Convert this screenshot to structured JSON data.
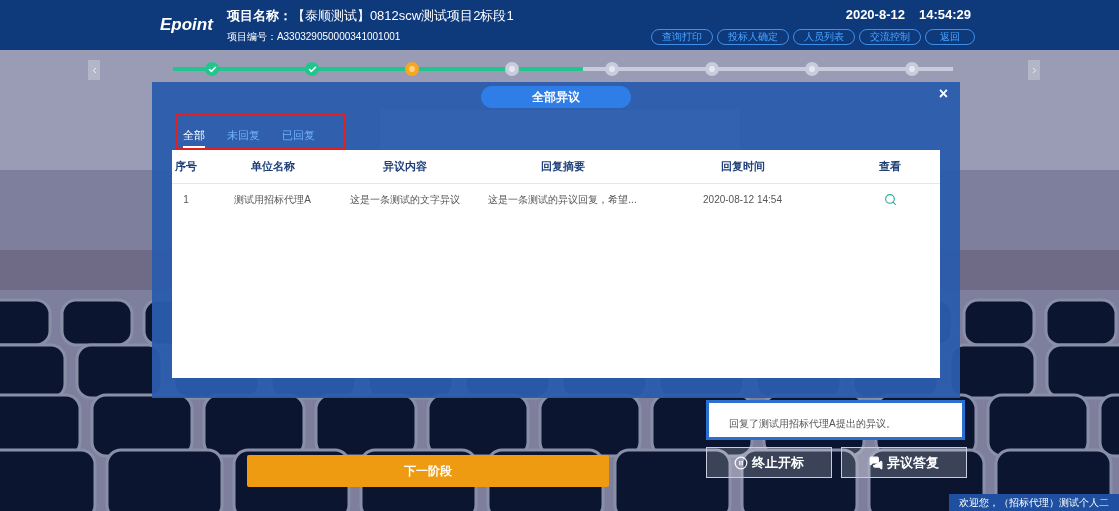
{
  "header": {
    "logo": "Epoint",
    "project_label": "项目名称：",
    "project_name": "【泰顺测试】0812scw测试项目2标段1",
    "code_label": "项目编号：",
    "code": "A330329050000341001001",
    "date": "2020-8-12",
    "time": "14:54:29",
    "buttons": [
      "查询打印",
      "投标人确定",
      "人员列表",
      "交流控制",
      "返回"
    ]
  },
  "steps": [
    {
      "kind": "done"
    },
    {
      "kind": "done"
    },
    {
      "kind": "current"
    },
    {
      "kind": "pending"
    },
    {
      "kind": "pending"
    },
    {
      "kind": "pending"
    },
    {
      "kind": "pending"
    },
    {
      "kind": "pending"
    }
  ],
  "dialog": {
    "title": "全部异议",
    "close": "×",
    "tabs": [
      {
        "label": "全部",
        "selected": true
      },
      {
        "label": "未回复",
        "selected": false
      },
      {
        "label": "已回复",
        "selected": false
      }
    ],
    "table": {
      "columns": [
        "序号",
        "单位名称",
        "异议内容",
        "回复摘要",
        "回复时间",
        "查看"
      ],
      "rows": [
        {
          "no": "1",
          "unit": "测试用招标代理A",
          "content": "这是一条测试的文字异议",
          "reply": "这是一条测试的异议回复，希望...",
          "time": "2020-08-12 14:54"
        }
      ]
    }
  },
  "side_card": {
    "text": "回复了测试用招标代理A提出的异议。"
  },
  "next_button": "下一阶段",
  "actions": [
    {
      "kind": "stop",
      "label": "终止开标"
    },
    {
      "kind": "reply",
      "label": "异议答复"
    }
  ],
  "welcome": "欢迎您，（招标代理）测试个人二"
}
